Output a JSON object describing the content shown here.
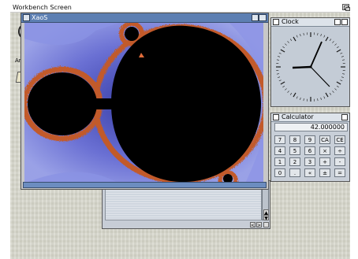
{
  "screen": {
    "title": "Workbench Screen"
  },
  "desktop": {
    "icon_label": "Ar"
  },
  "xaos": {
    "title": "XaoS"
  },
  "clock": {
    "title": "Clock"
  },
  "calculator": {
    "title": "Calculator",
    "display": "42.000000",
    "keys": [
      [
        "7",
        "8",
        "9",
        "CA",
        "CE"
      ],
      [
        "4",
        "5",
        "6",
        "×",
        "÷"
      ],
      [
        "1",
        "2",
        "3",
        "+",
        "-"
      ],
      [
        "0",
        ".",
        "«",
        "±",
        "="
      ]
    ]
  },
  "lower_window": {
    "arrows": {
      "up": "▲",
      "down": "▼",
      "left": "<",
      "right": ">"
    }
  },
  "colors": {
    "xaos_titlebar": "#5d7fb2",
    "fractal_outer": "#5b64c8",
    "fractal_set": "#000000"
  }
}
